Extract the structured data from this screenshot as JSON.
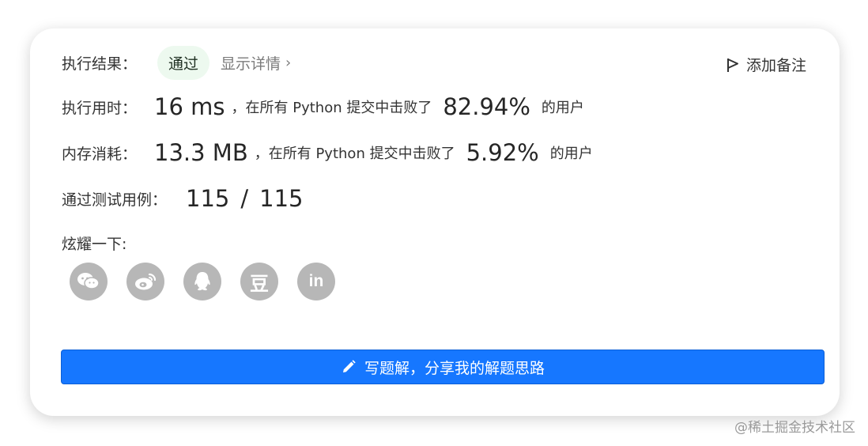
{
  "result": {
    "label": "执行结果：",
    "status": "通过",
    "detail_link": "显示详情",
    "note_button": "添加备注"
  },
  "runtime": {
    "label": "执行用时：",
    "value": "16 ms",
    "prefix": "，在所有 Python 提交中击败了",
    "percent": "82.94%",
    "suffix": "的用户"
  },
  "memory": {
    "label": "内存消耗：",
    "value": "13.3 MB",
    "prefix": "，在所有 Python 提交中击败了",
    "percent": "5.92%",
    "suffix": "的用户"
  },
  "tests": {
    "label": "通过测试用例：",
    "passed": "115",
    "separator": "/",
    "total": "115"
  },
  "share": {
    "label": "炫耀一下:",
    "icons": [
      "wechat-icon",
      "weibo-icon",
      "qq-icon",
      "douban-icon",
      "linkedin-icon"
    ],
    "douban_glyph": "豆",
    "linkedin_glyph": "in"
  },
  "cta": {
    "label": "写题解，分享我的解题思路"
  },
  "watermark": "@稀土掘金技术社区",
  "colors": {
    "primary": "#1677ff",
    "badge_bg": "#edf9ef",
    "icon_bg": "#b7b7b7"
  }
}
